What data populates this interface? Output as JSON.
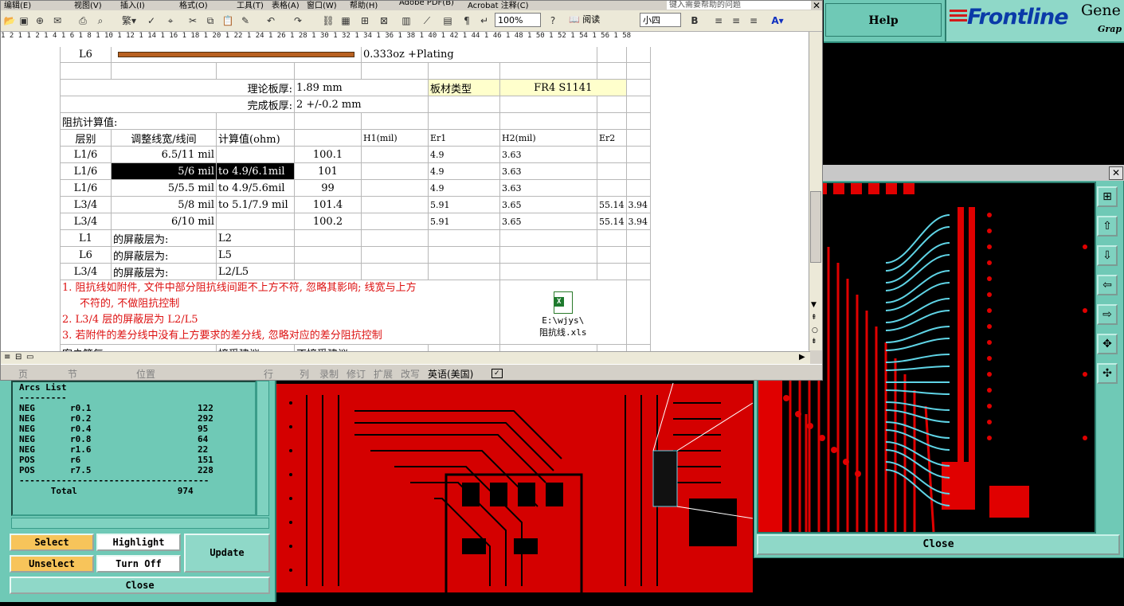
{
  "word": {
    "menu": [
      "编辑(E)",
      "视图(V)",
      "插入(I)",
      "格式(O)",
      "工具(T)",
      "表格(A)",
      "窗口(W)",
      "帮助(H)",
      "Adobe PDF(B)",
      "Acrobat 注释(C)"
    ],
    "help_search_placeholder": "键入需要帮助的问题",
    "zoom": "100%",
    "read_label": "阅读",
    "font_size": "小四",
    "ruler": "1 2 1 1 2 1 4 1 6 1 8 1 10 1 12 1 14 1 16 1 18 1 20 1 22 1 24 1 26 1 28 1 30 1 32 1 34 1 36 1 38 1 40 1 42 1 44 1 46 1 48 1 50 1 52 1 54 1 56 1 58",
    "table": {
      "row_l6": {
        "layer": "L6",
        "plating": "0.333oz +Plating"
      },
      "thickness_label": "理论板厚:",
      "thickness_value": "1.89 mm",
      "material_label": "板材类型",
      "material_value": "FR4 S1141",
      "finished_label": "完成板厚:",
      "finished_value": "2 +/-0.2 mm",
      "impedance_title": "阻抗计算值:",
      "headers": [
        "层别",
        "调整线宽/线间",
        "计算值(ohm)",
        "",
        "H1(mil)",
        "Er1",
        "H2(mil)",
        "Er2"
      ],
      "rows": [
        {
          "layer": "L1/6",
          "width": "6.5/11 mil",
          "to": "",
          "calc": "100.1",
          "h1": "4.9",
          "er1": "3.63",
          "h2": "",
          "er2": ""
        },
        {
          "layer": "L1/6",
          "width": "5/6 mil",
          "to": "to  4.9/6.1mil",
          "calc": "101",
          "h1": "4.9",
          "er1": "3.63",
          "h2": "",
          "er2": ""
        },
        {
          "layer": "L1/6",
          "width": "5/5.5 mil",
          "to": "to  4.9/5.6mil",
          "calc": "99",
          "h1": "4.9",
          "er1": "3.63",
          "h2": "",
          "er2": ""
        },
        {
          "layer": "L3/4",
          "width": "5/8 mil",
          "to": "to  5.1/7.9 mil",
          "calc": "101.4",
          "h1": "5.91",
          "er1": "3.65",
          "h2": "55.14",
          "er2": "3.94"
        },
        {
          "layer": "L3/4",
          "width": "6/10 mil",
          "to": "",
          "calc": "100.2",
          "h1": "5.91",
          "er1": "3.65",
          "h2": "55.14",
          "er2": "3.94"
        }
      ],
      "shield_rows": [
        {
          "layer": "L1",
          "label": "的屏蔽层为:",
          "value": "L2"
        },
        {
          "layer": "L6",
          "label": "的屏蔽层为:",
          "value": "L5"
        },
        {
          "layer": "L3/4",
          "label": "的屏蔽层为:",
          "value": "L2/L5"
        }
      ],
      "notes": [
        "1. 阻抗线如附件, 文件中部分阻抗线间距不上方不符, 忽略其影响; 线宽与上方",
        "不符的, 不做阻抗控制",
        "2. L3/4 层的屏蔽层为 L2/L5",
        "3. 若附件的差分线中没有上方要求的差分线, 忽略对应的差分阻抗控制"
      ],
      "attachment_path": "E:\\wjys\\",
      "attachment_name": "阻抗线.xls",
      "last_row": {
        "c1": "客户答复",
        "c2": "接受建议",
        "c3": "不接受建议"
      }
    },
    "status": [
      "页",
      "节",
      "位置",
      "行",
      "列",
      "录制",
      "修订",
      "扩展",
      "改写",
      "英语(美国)"
    ]
  },
  "frontline": {
    "help_label": "Help",
    "logo": "Frontline",
    "logo_suffix": "Gene",
    "logo_sub": "Grap"
  },
  "report": {
    "header": "Arcs List",
    "divider": "---------",
    "rows": [
      {
        "pol": "NEG",
        "sym": "r0.1",
        "count": "122"
      },
      {
        "pol": "NEG",
        "sym": "r0.2",
        "count": "292"
      },
      {
        "pol": "NEG",
        "sym": "r0.4",
        "count": "95"
      },
      {
        "pol": "NEG",
        "sym": "r0.8",
        "count": "64"
      },
      {
        "pol": "NEG",
        "sym": "r1.6",
        "count": "22"
      },
      {
        "pol": "POS",
        "sym": "r6",
        "count": "151"
      },
      {
        "pol": "POS",
        "sym": "r7.5",
        "count": "228"
      }
    ],
    "rule": "------------------------------------",
    "total_label": "Total",
    "total_value": "974",
    "buttons": {
      "select": "Select",
      "unselect": "Unselect",
      "highlight": "Highlight",
      "turn_off": "Turn Off",
      "update": "Update",
      "close": "Close"
    }
  },
  "zoom_window": {
    "close_label": "Close",
    "tools": [
      "zoom-fit-icon",
      "layer-up-icon",
      "layer-down-icon",
      "pan-left-icon",
      "pan-right-icon",
      "zoom-in-icon",
      "zoom-out-icon"
    ]
  },
  "colors": {
    "pcb_red": "#e00000",
    "diff_pair": "#5fd4e6",
    "panel": "#6fc9b6",
    "button_orange": "#f7c45a"
  }
}
